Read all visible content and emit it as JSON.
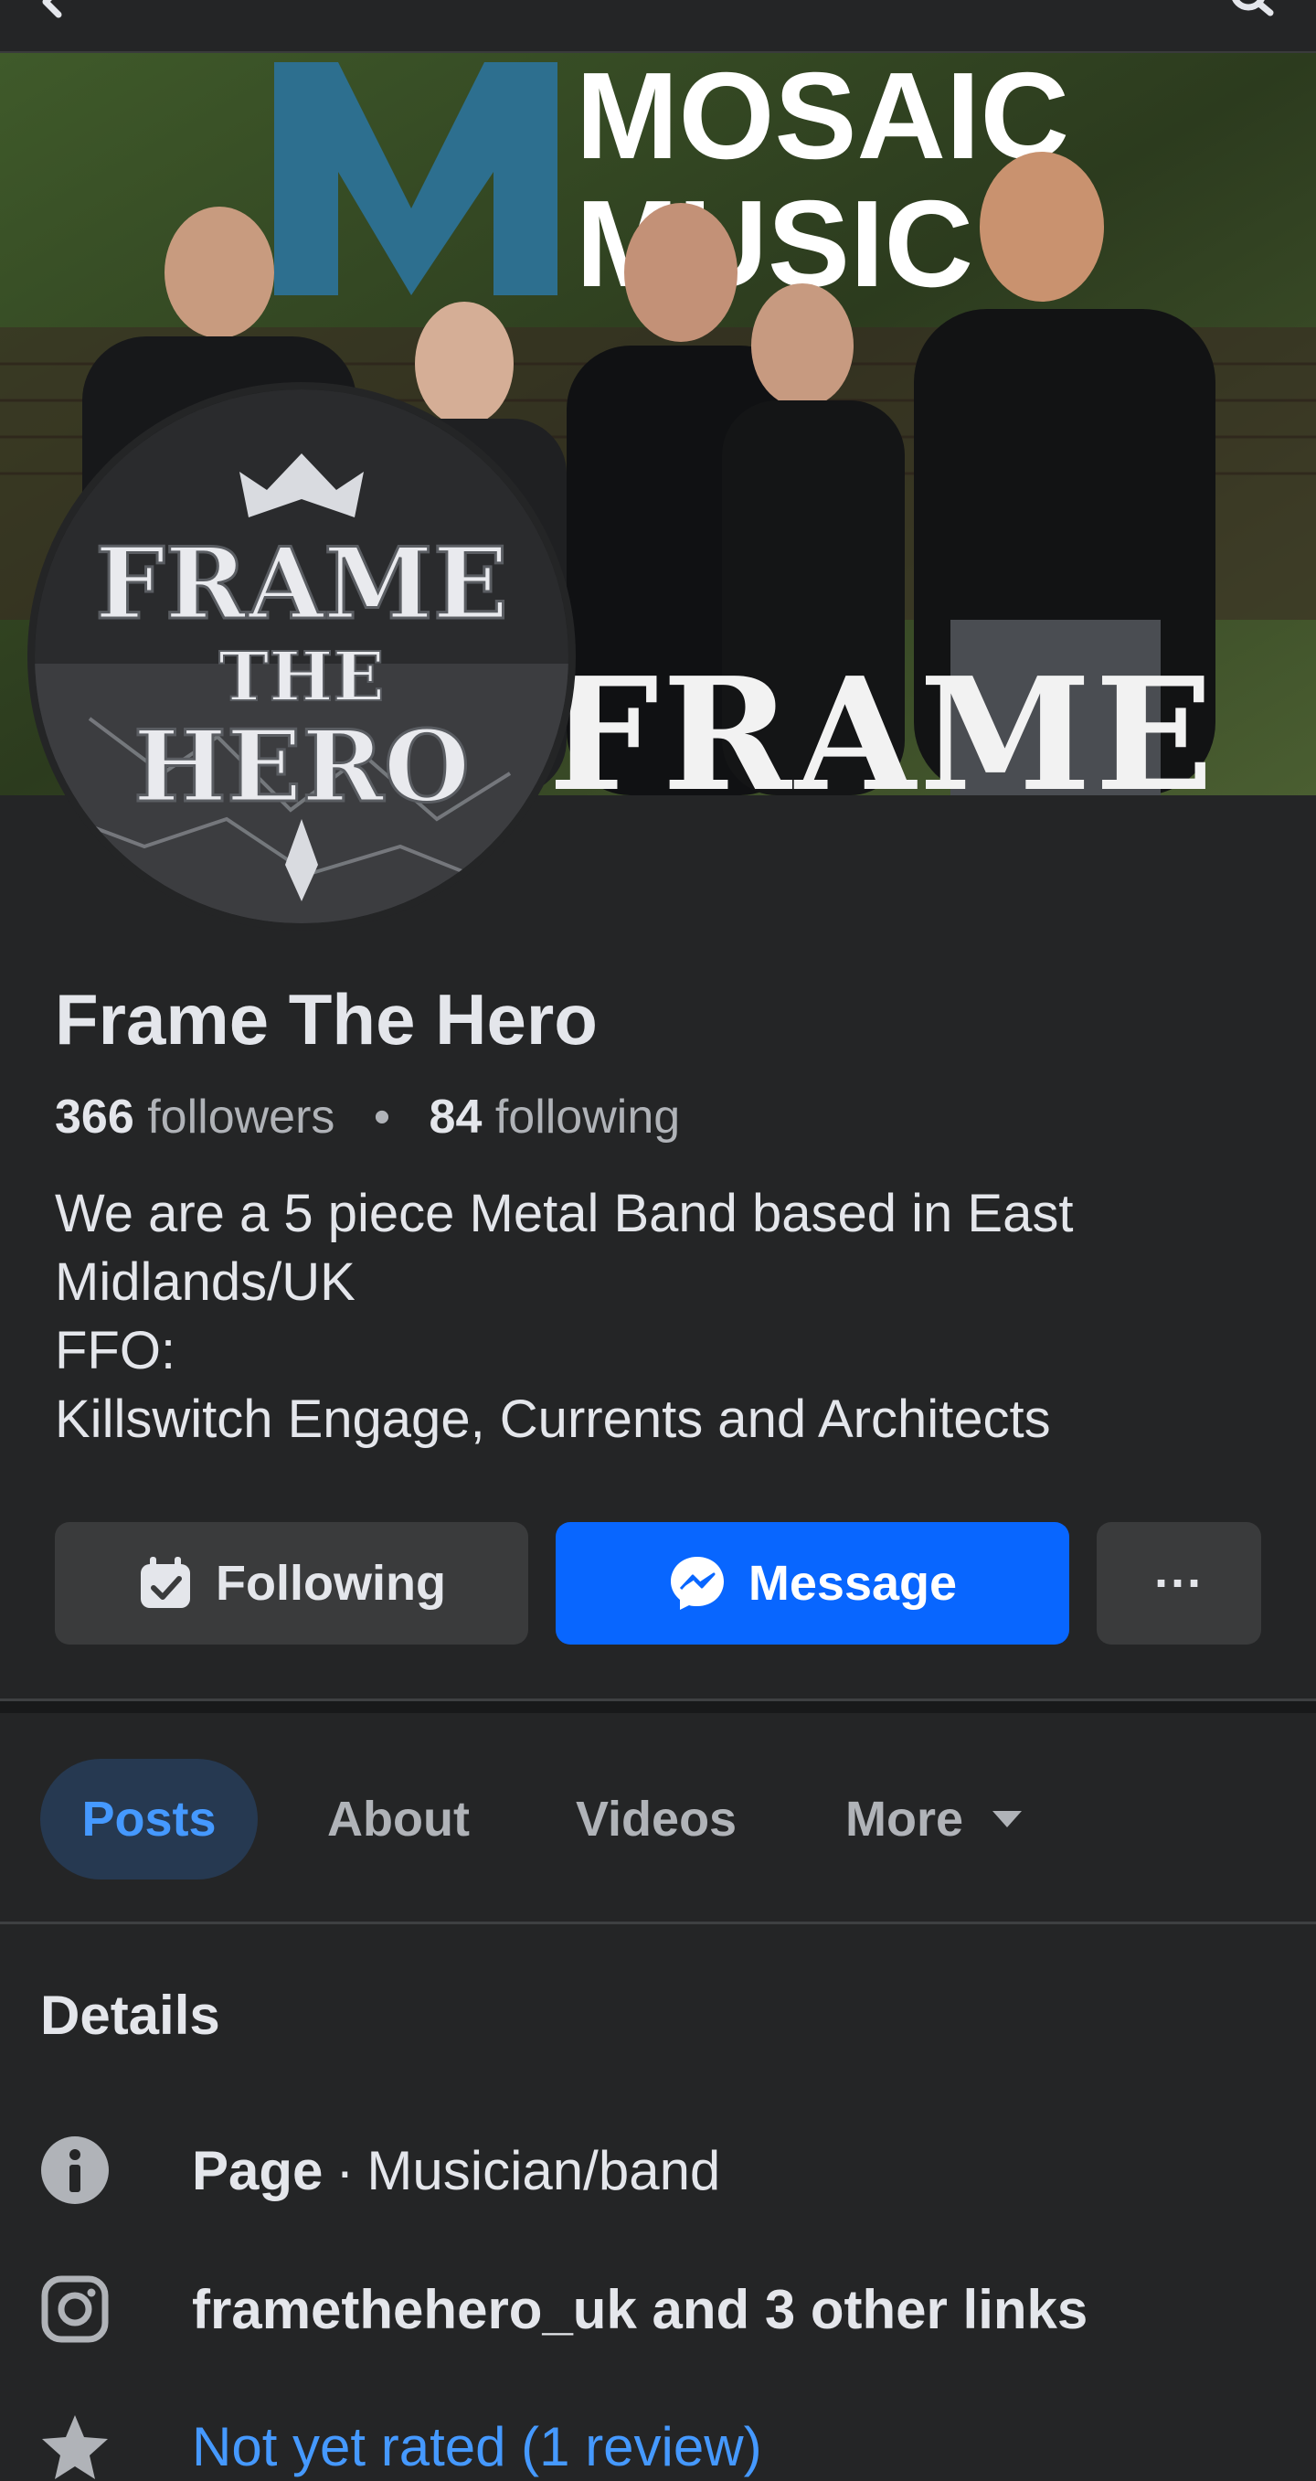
{
  "cover": {
    "brand_line1": "MOSAIC",
    "brand_line2": "MUSIC",
    "band_logo_text": "FRAME"
  },
  "avatar": {
    "logo_line1": "FRAME",
    "logo_line2": "THE",
    "logo_line3": "HERO"
  },
  "profile": {
    "name": "Frame The Hero",
    "followers_count": "366",
    "followers_label": "followers",
    "separator": "•",
    "following_count": "84",
    "following_label": "following",
    "bio_lines": [
      "We are a 5 piece Metal Band based in East",
      "Midlands/UK",
      "FFO:",
      "Killswitch Engage, Currents and Architects"
    ]
  },
  "actions": {
    "following_label": "Following",
    "message_label": "Message",
    "more_label": "···"
  },
  "tabs": [
    {
      "label": "Posts",
      "active": true
    },
    {
      "label": "About",
      "active": false
    },
    {
      "label": "Videos",
      "active": false
    },
    {
      "label": "More",
      "active": false
    }
  ],
  "details": {
    "title": "Details",
    "page_label": "Page",
    "page_separator": "·",
    "page_category": "Musician/band",
    "links_text": "framethehero_uk and 3 other links",
    "rating_text": "Not yet rated (1 review)"
  },
  "colors": {
    "background": "#242526",
    "primary_button": "#0866ff",
    "secondary_button": "#3a3b3c",
    "active_tab_bg": "#263951",
    "link_blue": "#4599ff",
    "cover_brand_blue": "#2d6f8f"
  },
  "icons": {
    "back": "arrow-left-icon",
    "search": "search-icon",
    "following": "check-calendar-icon",
    "message": "messenger-icon",
    "more": "ellipsis-icon",
    "tab_caret": "caret-down-icon",
    "page": "info-icon",
    "links": "instagram-icon",
    "rating": "star-icon"
  }
}
